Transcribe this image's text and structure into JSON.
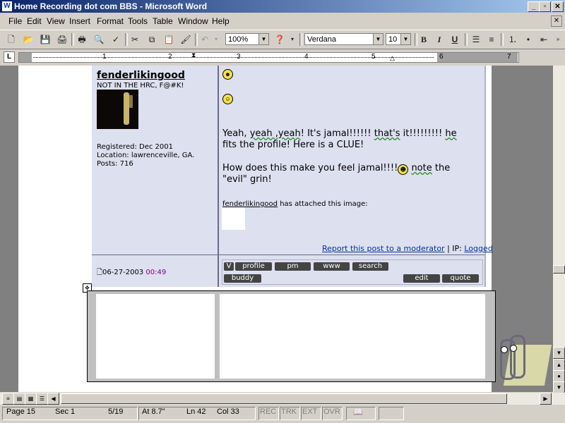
{
  "window": {
    "title": "Home Recording dot com BBS - Microsoft Word",
    "app_icon": "W",
    "min": "_",
    "max": "▫",
    "close": "✕"
  },
  "menu": [
    "File",
    "Edit",
    "View",
    "Insert",
    "Format",
    "Tools",
    "Table",
    "Window",
    "Help"
  ],
  "toolbar": {
    "zoom": "100%",
    "font": "Verdana",
    "size": "10",
    "bold": "B",
    "italic": "I",
    "underline": "U"
  },
  "ruler": {
    "numbers": [
      "1",
      "2",
      "3",
      "4",
      "5",
      "6",
      "7"
    ]
  },
  "post": {
    "username": "fenderlikingood",
    "user_title": "NOT IN THE HRC, F@#K!",
    "registered": "Registered: Dec 2001",
    "location": "Location: lawrenceville, GA.",
    "posts": "Posts: 716",
    "msg1a": "Yeah, ",
    "msg1b": "yeah ,yeah",
    "msg1c": "! It's jamal!!!!!! ",
    "msg1d": "that's",
    "msg1e": " it!!!!!!!!! ",
    "msg1f": "he",
    "msg1g": "fits the profile! Here is a CLUE!",
    "msg2a": "How does this make you feel jamal!!!!",
    "msg2b": "note",
    "msg2c": " the",
    "msg2d": "\"evil\" grin!",
    "attach_user": "fenderlikingood",
    "attach_text": " has attached this image:",
    "report_link": "Report this post to a moderator",
    "ip_label": " | IP: ",
    "ip_link": "Logged",
    "date": "06-27-2003",
    "time": "00:49",
    "buttons": {
      "profile": "profile",
      "pm": "pm",
      "www": "www",
      "search": "search",
      "buddy": "buddy",
      "edit": "edit",
      "quote": "quote"
    }
  },
  "status": {
    "page": "Page 15",
    "sec": "Sec 1",
    "pages": "5/19",
    "at": "At 8.7\"",
    "ln": "Ln 42",
    "col": "Col 33",
    "rec": "REC",
    "trk": "TRK",
    "ext": "EXT",
    "ovr": "OVR"
  }
}
